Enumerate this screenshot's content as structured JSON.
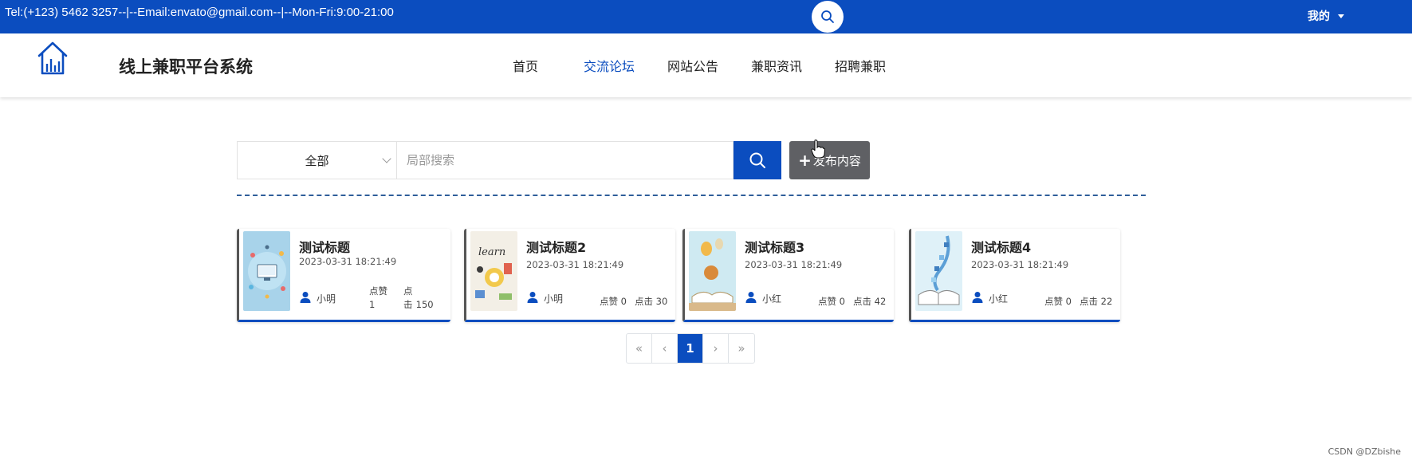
{
  "topbar": {
    "contact": "Tel:(+123) 5462 3257--|--Email:envato@gmail.com--|--Mon-Fri:9:00-21:00",
    "search_icon": "search-icon",
    "mine_label": "我的",
    "color": "#0b4dbf"
  },
  "header": {
    "logo_icon": "house-chart-icon",
    "site_title": "线上兼职平台系统",
    "nav": [
      {
        "label": "首页",
        "active": false
      },
      {
        "label": "交流论坛",
        "active": true
      },
      {
        "label": "网站公告",
        "active": false
      },
      {
        "label": "兼职资讯",
        "active": false
      },
      {
        "label": "招聘兼职",
        "active": false
      }
    ]
  },
  "search": {
    "category_selected": "全部",
    "placeholder": "局部搜索",
    "value": "",
    "publish_label": "发布内容"
  },
  "posts": [
    {
      "title": "测试标题",
      "date": "2023-03-31 18:21:49",
      "author": "小明",
      "likes_label": "点赞",
      "likes": "1",
      "clicks_label": "点击",
      "clicks": "150"
    },
    {
      "title": "测试标题2",
      "date": "2023-03-31 18:21:49",
      "author": "小明",
      "likes_label": "点赞",
      "likes": "0",
      "clicks_label": "点击",
      "clicks": "30"
    },
    {
      "title": "测试标题3",
      "date": "2023-03-31 18:21:49",
      "author": "小红",
      "likes_label": "点赞",
      "likes": "0",
      "clicks_label": "点击",
      "clicks": "42"
    },
    {
      "title": "测试标题4",
      "date": "2023-03-31 18:21:49",
      "author": "小红",
      "likes_label": "点赞",
      "likes": "0",
      "clicks_label": "点击",
      "clicks": "22"
    }
  ],
  "pagination": {
    "first": "«",
    "prev": "‹",
    "current": "1",
    "next": "›",
    "last": "»"
  },
  "watermark": "CSDN @DZbishe"
}
